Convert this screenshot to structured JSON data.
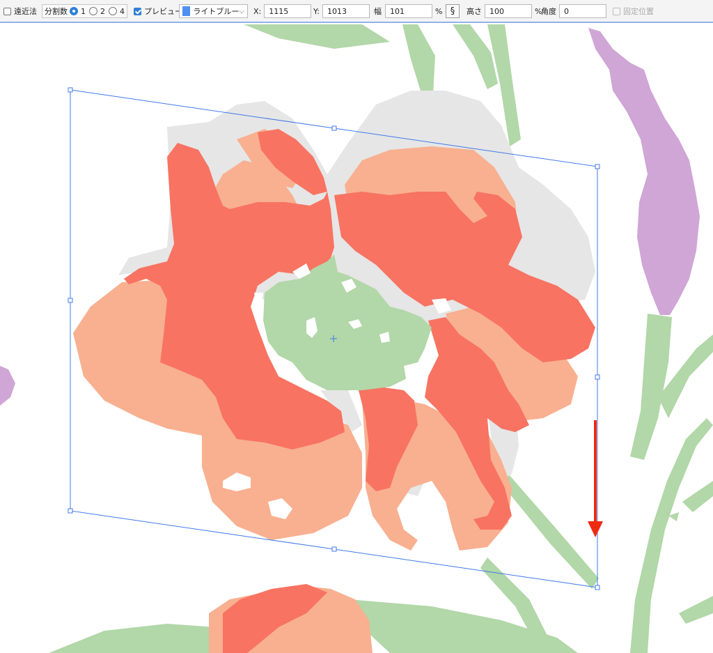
{
  "toolbar": {
    "perspective_label": "遠近法",
    "divisions_label": "分割数",
    "division_options": [
      "1",
      "2",
      "4"
    ],
    "preview_label": "プレビュー",
    "color_label": "ライトブルー",
    "x_label": "X:",
    "x_value": "1115",
    "y_label": "Y:",
    "y_value": "1013",
    "width_label": "幅",
    "width_value": "101",
    "width_unit": "%",
    "link_symbol": "§",
    "height_label": "高さ",
    "height_value": "100",
    "height_unit": "%",
    "angle_label": "角度",
    "angle_value": "0",
    "fixed_position_label": "固定位置"
  },
  "colors": {
    "bounding_box": "#3f79e8",
    "swatch": "#4f8fef",
    "arrow": "#ee2a10",
    "petal_red": "#f87362",
    "petal_peach": "#f8b090",
    "leaf_green": "#b2d7a8",
    "shadow_gray": "#e6e6e6",
    "lavender": "#cfa6d6"
  },
  "icons": {
    "link": "chain-link-icon",
    "arrow": "down-arrow-icon",
    "center": "crosshair-icon"
  }
}
